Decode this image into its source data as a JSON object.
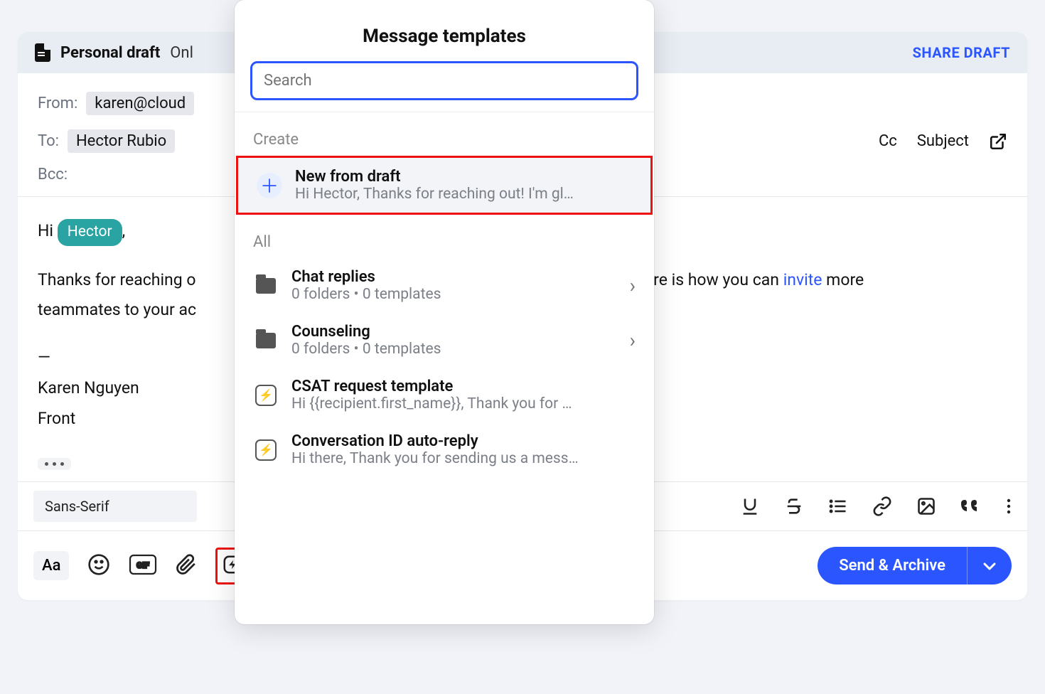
{
  "header": {
    "title": "Personal draft",
    "visibility": "Onl",
    "share_label": "SHARE DRAFT"
  },
  "fields": {
    "from_label": "From:",
    "from_value": "karen@cloud",
    "to_label": "To:",
    "to_value": "Hector Rubio",
    "cc_label": "Cc",
    "subject_label": "Subject",
    "bcc_label": "Bcc:"
  },
  "body": {
    "greeting_prefix": "Hi ",
    "mention": "Hector",
    "greeting_suffix": ",",
    "line1_a": "Thanks for reaching o",
    "line1_b": "ere is how you can ",
    "link_text": "invite",
    "line1_c": " more",
    "line2": "teammates to your ac",
    "sig1": "—",
    "sig2": "Karen Nguyen",
    "sig3": "Front"
  },
  "format": {
    "font": "Sans-Serif"
  },
  "send": {
    "label": "Send & Archive"
  },
  "popover": {
    "title": "Message templates",
    "search_placeholder": "Search",
    "create_label": "Create",
    "new_from_draft": {
      "title": "New from draft",
      "preview": "Hi Hector, Thanks for reaching out! I'm gl…"
    },
    "all_label": "All",
    "items": [
      {
        "type": "folder",
        "title": "Chat replies",
        "sub": "0 folders • 0 templates"
      },
      {
        "type": "folder",
        "title": "Counseling",
        "sub": "0 folders • 0 templates"
      },
      {
        "type": "template",
        "title": "CSAT request template",
        "sub": "Hi {{recipient.first_name}}, Thank you for …"
      },
      {
        "type": "template",
        "title": "Conversation ID auto-reply",
        "sub": "Hi there, Thank you for sending us a mess…"
      }
    ]
  }
}
